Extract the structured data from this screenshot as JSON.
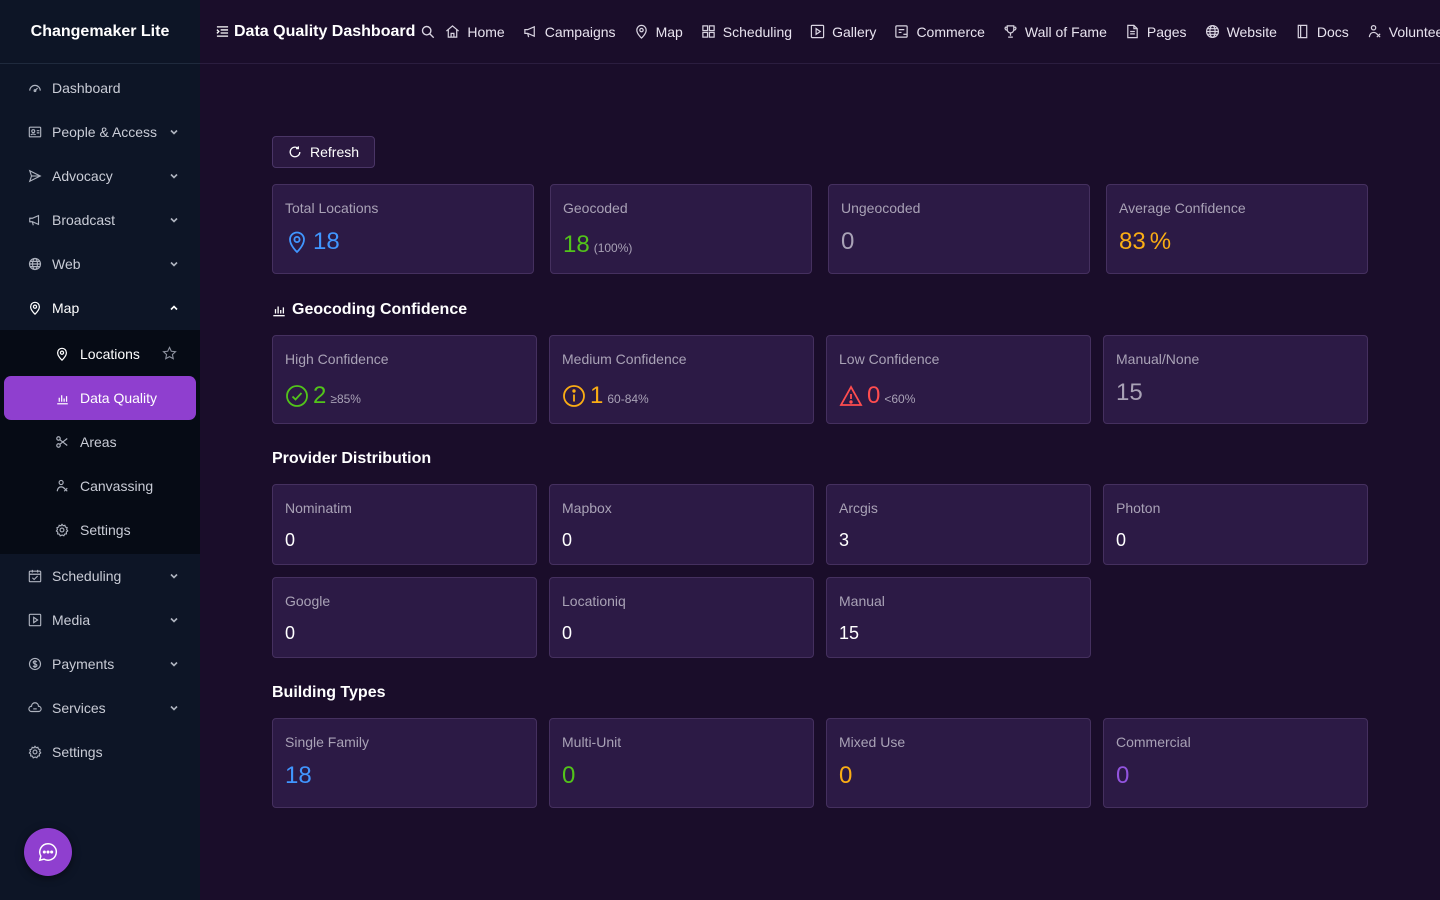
{
  "app": {
    "title": "Changemaker Lite"
  },
  "sidebar": {
    "items": [
      {
        "label": "Dashboard",
        "icon": "dashboard-icon"
      },
      {
        "label": "People & Access",
        "icon": "people-icon",
        "expandable": true
      },
      {
        "label": "Advocacy",
        "icon": "send-icon",
        "expandable": true
      },
      {
        "label": "Broadcast",
        "icon": "megaphone-icon",
        "expandable": true
      },
      {
        "label": "Web",
        "icon": "globe-icon",
        "expandable": true
      },
      {
        "label": "Map",
        "icon": "map-pin-icon",
        "expanded": true
      }
    ],
    "map_sub": [
      {
        "label": "Locations",
        "icon": "map-pin-icon",
        "favorite": true
      },
      {
        "label": "Data Quality",
        "icon": "bar-chart-icon",
        "selected": true
      },
      {
        "label": "Areas",
        "icon": "scissors-icon"
      },
      {
        "label": "Canvassing",
        "icon": "walker-icon"
      },
      {
        "label": "Settings",
        "icon": "gear-icon"
      }
    ],
    "items_after": [
      {
        "label": "Scheduling",
        "icon": "calendar-icon",
        "expandable": true
      },
      {
        "label": "Media",
        "icon": "play-square-icon",
        "expandable": true
      },
      {
        "label": "Payments",
        "icon": "dollar-circle-icon",
        "expandable": true
      },
      {
        "label": "Services",
        "icon": "cloud-icon",
        "expandable": true
      },
      {
        "label": "Settings",
        "icon": "gear-icon"
      }
    ]
  },
  "header": {
    "title": "Data Quality Dashboard",
    "links": [
      {
        "label": "Home",
        "icon": "home-icon"
      },
      {
        "label": "Campaigns",
        "icon": "megaphone-icon"
      },
      {
        "label": "Map",
        "icon": "map-pin-icon"
      },
      {
        "label": "Scheduling",
        "icon": "grid-icon"
      },
      {
        "label": "Gallery",
        "icon": "play-square-icon"
      },
      {
        "label": "Commerce",
        "icon": "shop-icon"
      },
      {
        "label": "Wall of Fame",
        "icon": "trophy-icon"
      },
      {
        "label": "Pages",
        "icon": "file-icon"
      },
      {
        "label": "Website",
        "icon": "globe-icon"
      },
      {
        "label": "Docs",
        "icon": "book-icon"
      },
      {
        "label": "Volunteer",
        "icon": "walker-icon"
      }
    ]
  },
  "main": {
    "refresh_label": "Refresh",
    "summary": {
      "total": {
        "title": "Total Locations",
        "value": "18"
      },
      "geocoded": {
        "title": "Geocoded",
        "value": "18",
        "sub": "(100%)"
      },
      "ungeocoded": {
        "title": "Ungeocoded",
        "value": "0"
      },
      "avg_conf": {
        "title": "Average Confidence",
        "value": "83",
        "unit": "%"
      }
    },
    "confidence": {
      "title": "Geocoding Confidence",
      "high": {
        "title": "High Confidence",
        "value": "2",
        "sub": "≥85%"
      },
      "medium": {
        "title": "Medium Confidence",
        "value": "1",
        "sub": "60-84%"
      },
      "low": {
        "title": "Low Confidence",
        "value": "0",
        "sub": "<60%"
      },
      "manual": {
        "title": "Manual/None",
        "value": "15"
      }
    },
    "providers": {
      "title": "Provider Distribution",
      "items": [
        {
          "name": "Nominatim",
          "value": "0"
        },
        {
          "name": "Mapbox",
          "value": "0"
        },
        {
          "name": "Arcgis",
          "value": "3"
        },
        {
          "name": "Photon",
          "value": "0"
        },
        {
          "name": "Google",
          "value": "0"
        },
        {
          "name": "Locationiq",
          "value": "0"
        },
        {
          "name": "Manual",
          "value": "15"
        }
      ]
    },
    "buildings": {
      "title": "Building Types",
      "single": {
        "title": "Single Family",
        "value": "18"
      },
      "multi": {
        "title": "Multi-Unit",
        "value": "0"
      },
      "mixed": {
        "title": "Mixed Use",
        "value": "0"
      },
      "commercial": {
        "title": "Commercial",
        "value": "0"
      }
    }
  },
  "colors": {
    "accent": "#8f3fcf",
    "blue": "#4096ff",
    "green": "#52c41a",
    "orange": "#faad14",
    "red": "#ff4d4f",
    "purple": "#9254de"
  }
}
